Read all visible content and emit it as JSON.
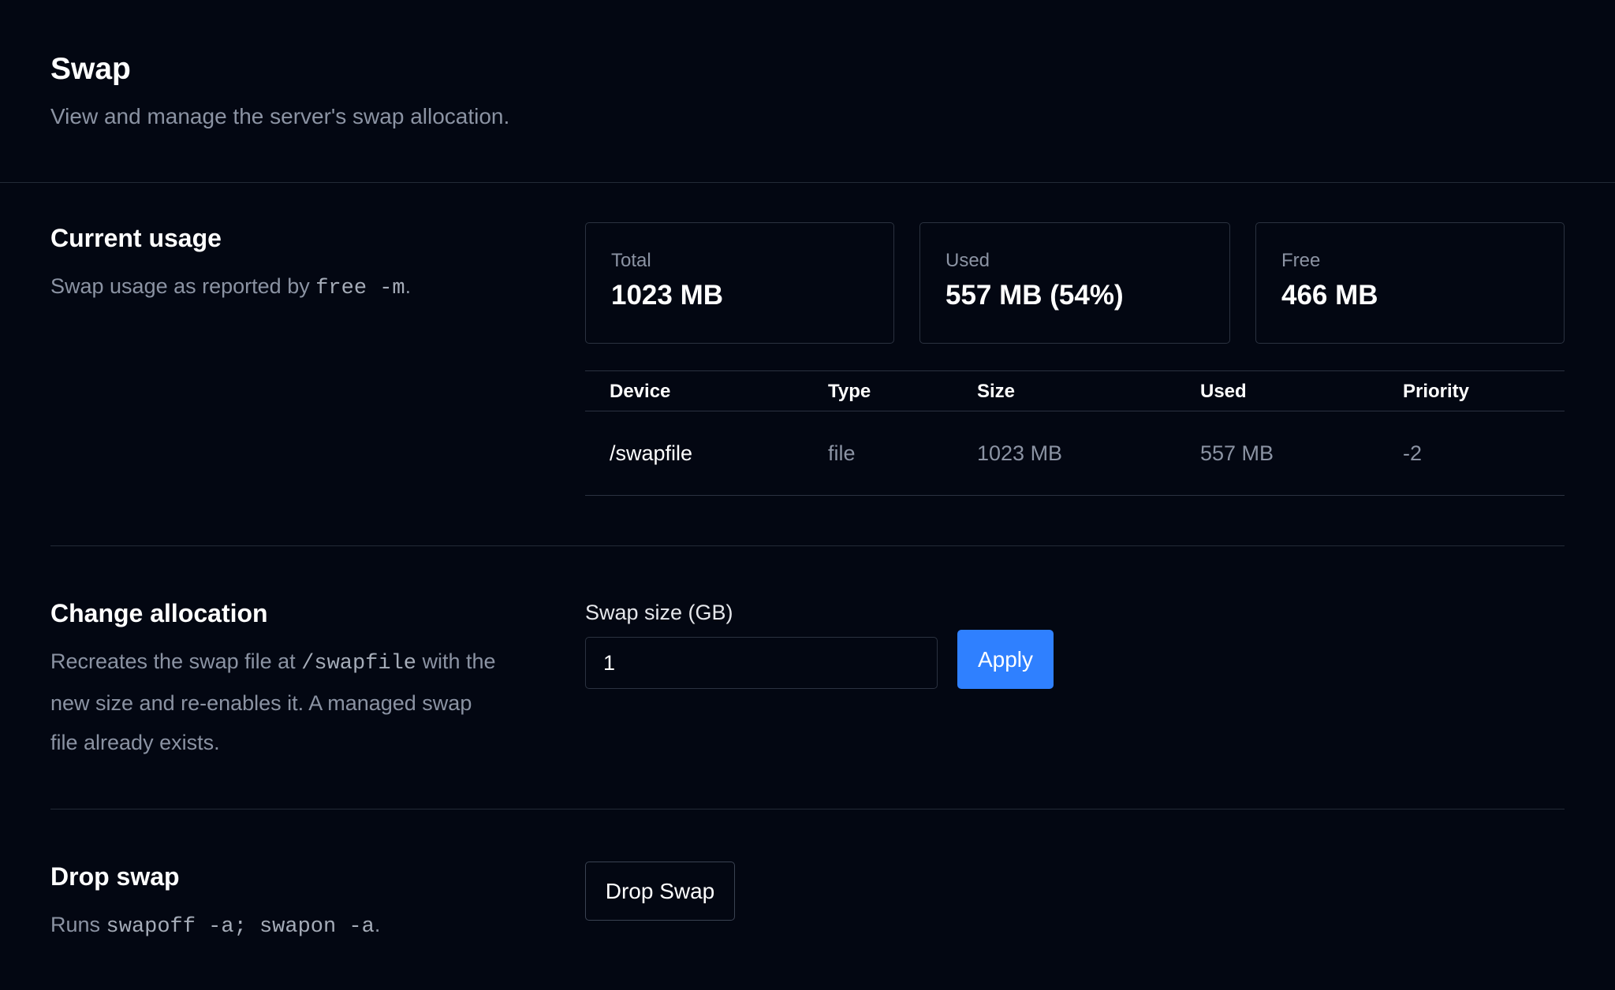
{
  "header": {
    "title": "Swap",
    "subtitle": "View and manage the server's swap allocation."
  },
  "current_usage": {
    "title": "Current usage",
    "desc_prefix": "Swap usage as reported by ",
    "desc_code": "free -m",
    "desc_suffix": ".",
    "stats": [
      {
        "label": "Total",
        "value": "1023 MB"
      },
      {
        "label": "Used",
        "value": "557 MB (54%)"
      },
      {
        "label": "Free",
        "value": "466 MB"
      }
    ],
    "table": {
      "headers": [
        "Device",
        "Type",
        "Size",
        "Used",
        "Priority"
      ],
      "rows": [
        [
          "/swapfile",
          "file",
          "1023 MB",
          "557 MB",
          "-2"
        ]
      ]
    }
  },
  "change_allocation": {
    "title": "Change allocation",
    "desc_prefix": "Recreates the swap file at ",
    "desc_code": "/swapfile",
    "desc_suffix": " with the new size and re-enables it. A managed swap file already exists.",
    "field_label": "Swap size (GB)",
    "field_value": "1",
    "apply_label": "Apply"
  },
  "drop_swap": {
    "title": "Drop swap",
    "desc_prefix": "Runs ",
    "desc_code": "swapoff -a; swapon -a",
    "desc_suffix": ".",
    "button_label": "Drop Swap"
  },
  "colors": {
    "background": "#030712",
    "accent": "#2f80ff",
    "border": "#2b3240",
    "muted_text": "#8b93a3"
  }
}
